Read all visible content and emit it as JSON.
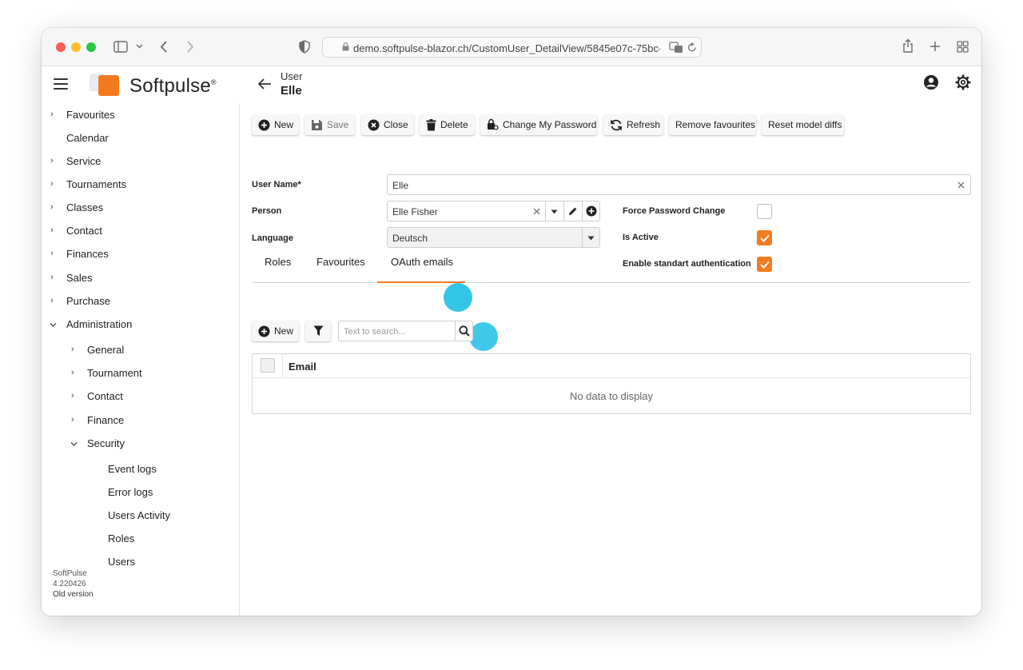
{
  "browser": {
    "url": "demo.softpulse-blazor.ch/CustomUser_DetailView/5845e07c-75bc-4"
  },
  "app": {
    "brand": "Softpulse",
    "brand_mark": "®",
    "breadcrumb_top": "User",
    "breadcrumb_main": "Elle"
  },
  "sidebar": {
    "items": [
      {
        "label": "Favourites"
      },
      {
        "label": "Calendar"
      },
      {
        "label": "Service"
      },
      {
        "label": "Tournaments"
      },
      {
        "label": "Classes"
      },
      {
        "label": "Contact"
      },
      {
        "label": "Finances"
      },
      {
        "label": "Sales"
      },
      {
        "label": "Purchase"
      },
      {
        "label": "Administration"
      }
    ],
    "admin_children": [
      {
        "label": "General"
      },
      {
        "label": "Tournament"
      },
      {
        "label": "Contact"
      },
      {
        "label": "Finance"
      },
      {
        "label": "Security"
      }
    ],
    "security_children": [
      {
        "label": "Event logs"
      },
      {
        "label": "Error logs"
      },
      {
        "label": "Users Activity"
      },
      {
        "label": "Roles"
      },
      {
        "label": "Users"
      }
    ],
    "version_lines": [
      "SoftPulse",
      "4.220426",
      "Old version"
    ]
  },
  "toolbar": {
    "new": "New",
    "save": "Save",
    "close": "Close",
    "delete": "Delete",
    "change_password": "Change My Password",
    "refresh": "Refresh",
    "remove_favourites": "Remove favourites",
    "reset_model_diffs": "Reset model diffs"
  },
  "form": {
    "user_name_label": "User Name*",
    "user_name_value": "Elle",
    "person_label": "Person",
    "person_value": "Elle Fisher",
    "language_label": "Language",
    "language_value": "Deutsch",
    "force_password_label": "Force Password Change",
    "force_password_checked": false,
    "is_active_label": "Is Active",
    "is_active_checked": true,
    "standard_auth_label": "Enable standart authentication",
    "standard_auth_checked": true
  },
  "tabs": [
    {
      "label": "Roles",
      "active": false
    },
    {
      "label": "Favourites",
      "active": false
    },
    {
      "label": "OAuth emails",
      "active": true
    }
  ],
  "list": {
    "new_label": "New",
    "search_placeholder": "Text to search...",
    "column_email": "Email",
    "empty_text": "No data to display"
  },
  "colors": {
    "accent": "#f47a20",
    "touch_indicator": "#1cbfe6"
  }
}
